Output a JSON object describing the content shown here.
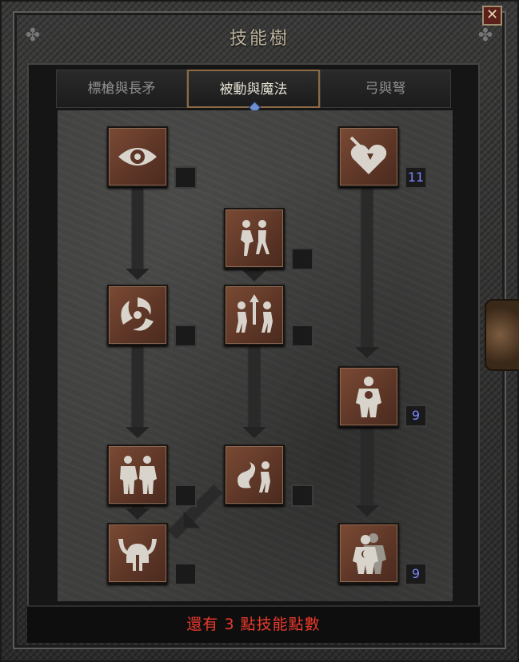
{
  "window": {
    "title": "技能樹",
    "close_icon": "close-icon"
  },
  "tabs": [
    {
      "label": "標槍與長矛",
      "active": false
    },
    {
      "label": "被動與魔法",
      "active": true
    },
    {
      "label": "弓與弩",
      "active": false
    }
  ],
  "skills": [
    {
      "icon": "eye-icon",
      "level": ""
    },
    {
      "icon": "heart-pierce-icon",
      "level": "11"
    },
    {
      "icon": "dodge-figures-icon",
      "level": ""
    },
    {
      "icon": "swirl-icon",
      "level": ""
    },
    {
      "icon": "avoid-figures-icon",
      "level": ""
    },
    {
      "icon": "figure-core-icon",
      "level": "9"
    },
    {
      "icon": "twin-figures-icon",
      "level": ""
    },
    {
      "icon": "evade-icon",
      "level": ""
    },
    {
      "icon": "horned-helmet-icon",
      "level": ""
    },
    {
      "icon": "shadow-figure-icon",
      "level": "9"
    }
  ],
  "footer": {
    "remaining_points_text": "還有 3 點技能點數"
  }
}
